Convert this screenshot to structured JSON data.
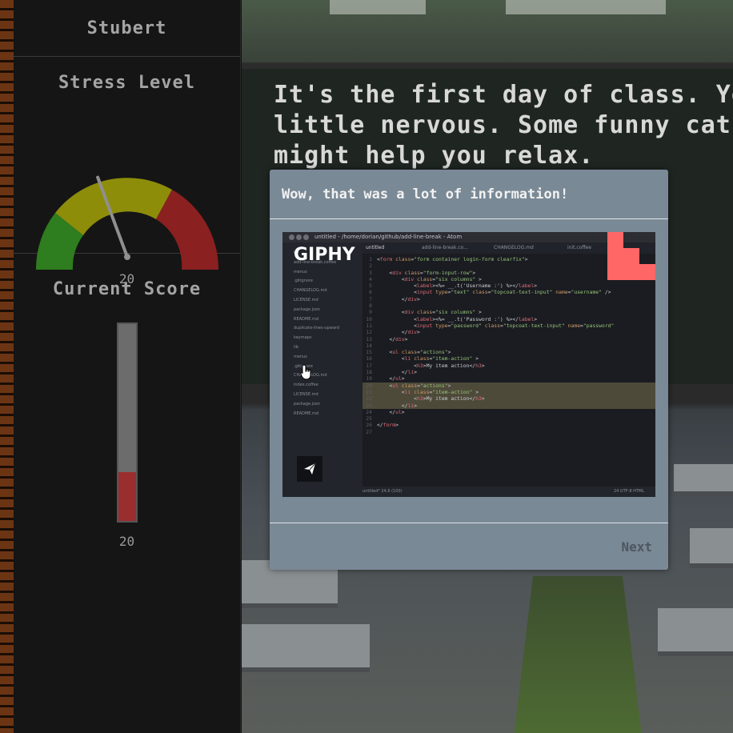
{
  "sidebar": {
    "player_name": "Stubert",
    "stress": {
      "heading": "Stress Level",
      "value": "20",
      "level_fraction": 0.2,
      "colors": {
        "low": "#2e7d1e",
        "mid": "#8d8d0a",
        "high": "#8a2020",
        "needle": "#8f8f8f"
      }
    },
    "score": {
      "heading": "Current Score",
      "value": "20",
      "fill_fraction": 0.25,
      "fill_color": "#9a2e2e"
    }
  },
  "story": {
    "lines": [
      "It's the first day of class. Yo",
      "little nervous. Some funny cat",
      "might help you relax."
    ]
  },
  "modal": {
    "title": "Wow, that was a lot of information!",
    "next_label": "Next",
    "gif": {
      "logo": "GIPHY",
      "share_icon": "paper-plane-icon",
      "editor_title": "untitled - /home/dorian/github/add-line-break - Atom",
      "tabs": [
        "untitled",
        "add-line-break.co...",
        "CHANGELOG.md",
        "init.coffee"
      ],
      "tree": [
        "lib",
        "add-line-break.coffee",
        "menus",
        ".gitignore",
        "CHANGELOG.md",
        "LICENSE.md",
        "package.json",
        "README.md",
        "duplicate-lines-upward",
        "keymaps",
        "lib",
        "menus",
        ".gitignore",
        "CHANGELOG.md",
        "index.coffee",
        "LICENSE.md",
        "package.json",
        "README.md"
      ],
      "status_left": "untitled*   24,6   (100)",
      "status_right": "24   UTF-8   HTML"
    }
  }
}
